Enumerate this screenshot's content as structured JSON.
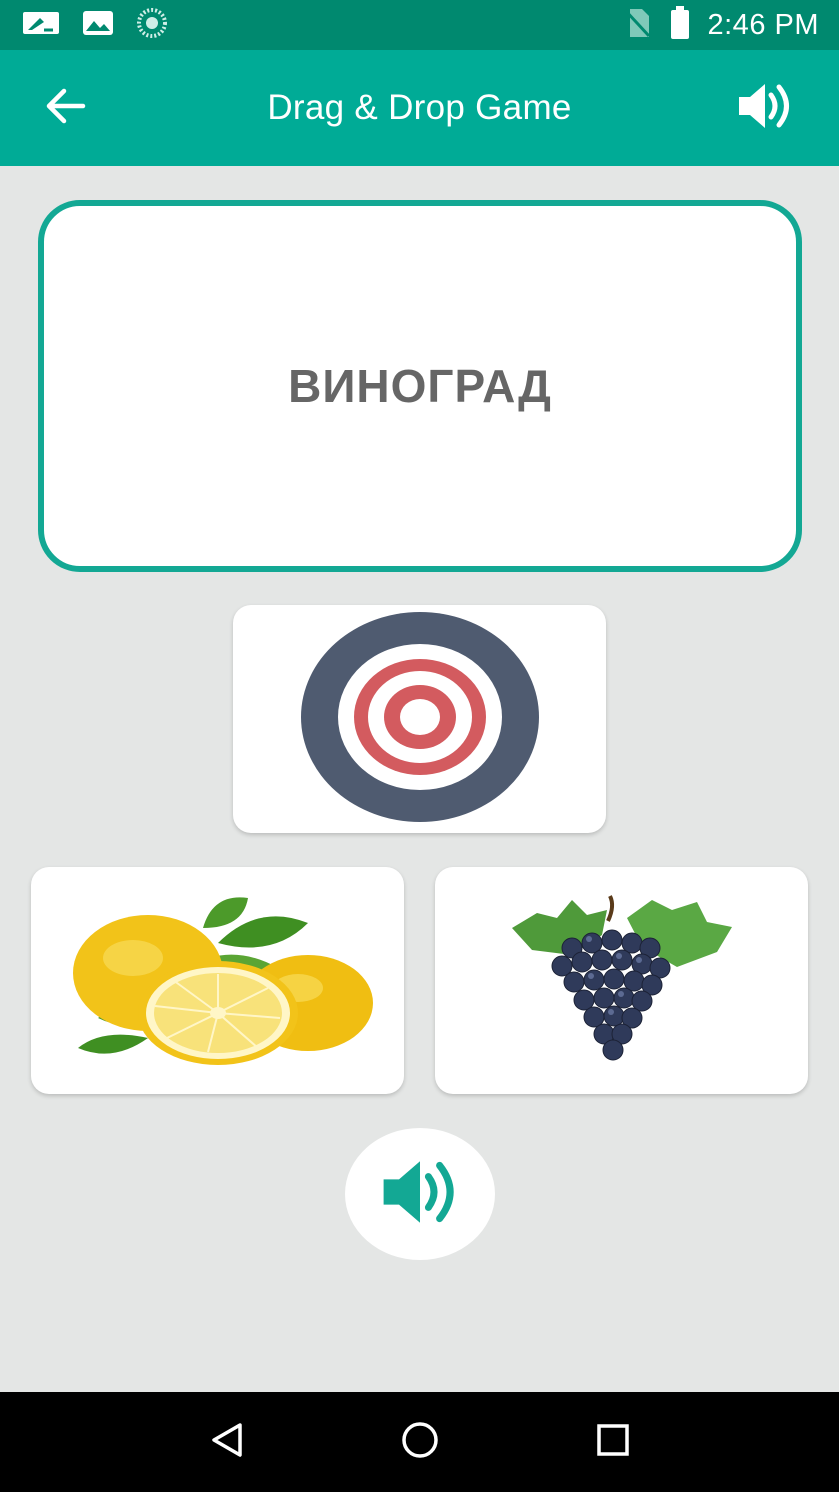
{
  "status_bar": {
    "time": "2:46 PM",
    "icons": [
      "notification-edit-icon",
      "image-icon",
      "sync-spinner-icon",
      "no-sim-icon",
      "battery-icon"
    ]
  },
  "app_bar": {
    "title": "Drag & Drop Game",
    "back_icon": "arrow-back-icon",
    "sound_icon": "speaker-icon",
    "color": "#00ab96"
  },
  "game": {
    "word": "ВИНОГРАД",
    "drop_target_icon": "target-icon",
    "options": [
      {
        "name": "lemon",
        "icon": "lemon-image"
      },
      {
        "name": "grapes",
        "icon": "grapes-image"
      }
    ],
    "play_sound_icon": "speaker-icon",
    "accent_color": "#13a894"
  },
  "nav_bar": {
    "buttons": [
      "back-triangle-icon",
      "home-circle-icon",
      "recents-square-icon"
    ]
  }
}
